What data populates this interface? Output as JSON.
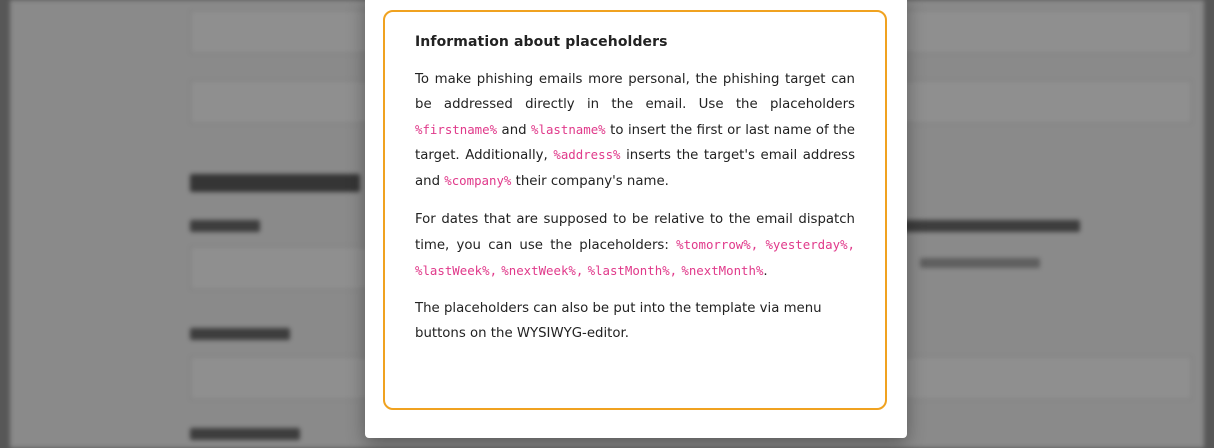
{
  "modal": {
    "title": "Information about placeholders",
    "paragraph1": {
      "t1": "To make phishing emails more personal, the phishing target can be addressed directly in the email. Use the placeholders ",
      "ph_firstname": "%firstname%",
      "t2": " and ",
      "ph_lastname": "%lastname%",
      "t3": " to insert the first or last name of the target. Additionally, ",
      "ph_address": "%address%",
      "t4": " inserts the target's email address and ",
      "ph_company": "%company%",
      "t5": " their company's name."
    },
    "paragraph2": {
      "t1": "For dates that are supposed to be relative to the email dispatch time, you can use the placeholders: ",
      "ph_tomorrow": "%tomorrow%,",
      "ph_yesterday": "%yesterday%,",
      "ph_lastweek": "%lastWeek%,",
      "ph_nextweek": "%nextWeek%,",
      "ph_lastmonth": "%lastMonth%,",
      "ph_nextmonth": "%nextMonth%",
      "t_end": "."
    },
    "paragraph3": "The placeholders can also be put into the template via menu buttons on the WYSIWYG-editor."
  },
  "colors": {
    "accent_border": "#f0a220",
    "placeholder_text": "#e0398a"
  }
}
